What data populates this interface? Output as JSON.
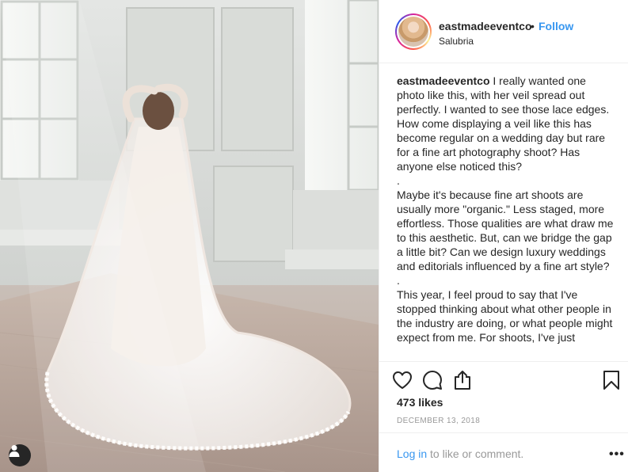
{
  "post": {
    "image_alt": "Bride in lace gown with long cathedral veil spread on wooden floor in a sunlit room",
    "tag_button_icon": "user-icon"
  },
  "header": {
    "username": "eastmadeeventco",
    "separator": "•",
    "follow_label": "Follow",
    "location": "Salubria",
    "avatar_icon": "profile-avatar"
  },
  "caption": {
    "username": "eastmadeeventco",
    "paragraph1": "I really wanted one photo like this, with her veil spread out perfectly. I wanted to see those lace edges. How come displaying a veil like this has become regular on a wedding day but rare for a fine art photography shoot? Has anyone else noticed this?",
    "sep1": ".",
    "paragraph2": "Maybe it's because fine art shoots are usually more \"organic.\" Less staged, more effortless. Those qualities are what draw me to this aesthetic. But, can we bridge the gap a little bit? Can we design luxury weddings and editorials influenced by a fine art style?",
    "sep2": ".",
    "paragraph3": "This year, I feel proud to say that I've stopped thinking about what other people in the industry are doing, or what people might expect from me. For shoots, I've just"
  },
  "actions": {
    "like_icon": "heart-icon",
    "comment_icon": "comment-icon",
    "share_icon": "share-icon",
    "save_icon": "bookmark-icon"
  },
  "likes_text": "473 likes",
  "date_text": "DECEMBER 13, 2018",
  "login": {
    "link_label": "Log in",
    "rest_text": " to like or comment."
  },
  "more_label": "•••",
  "colors": {
    "link": "#3897f0",
    "text": "#262626",
    "muted": "#999999",
    "border": "#efefef"
  }
}
